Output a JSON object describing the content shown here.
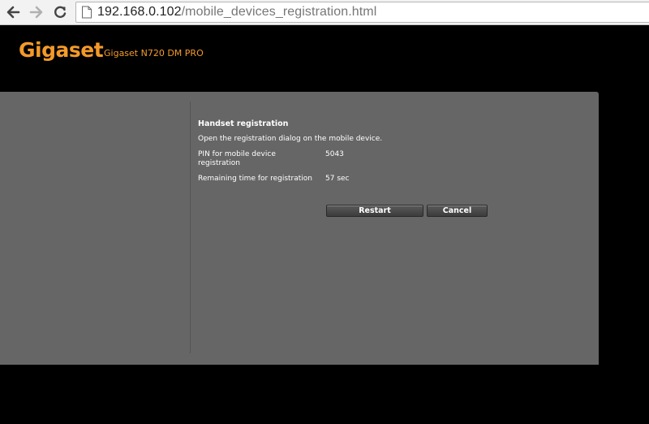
{
  "browser": {
    "url_host": "192.168.0.102",
    "url_path": "/mobile_devices_registration.html"
  },
  "header": {
    "logo": "Gigaset",
    "model": "Gigaset N720 DM PRO"
  },
  "registration": {
    "title": "Handset registration",
    "instruction": "Open the registration dialog on the mobile device.",
    "pin_label": "PIN for mobile device registration",
    "pin_value": "5043",
    "remaining_label": "Remaining time for registration",
    "remaining_value": "57 sec",
    "restart_label": "Restart",
    "cancel_label": "Cancel"
  },
  "colors": {
    "brand": "#f39a2a",
    "panel": "#666666",
    "background": "#000000"
  }
}
